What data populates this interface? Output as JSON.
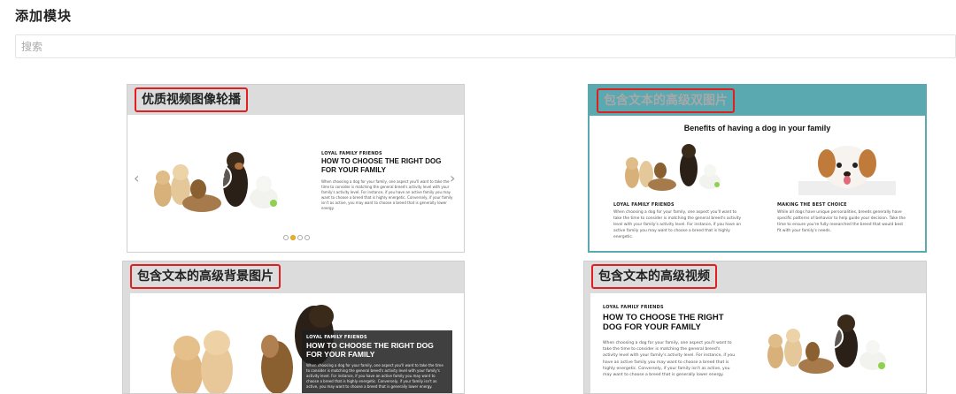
{
  "page": {
    "title": "添加模块"
  },
  "search": {
    "placeholder": "搜索"
  },
  "cards": [
    {
      "label": "优质视频图像轮播",
      "kicker": "LOYAL FAMILY FRIENDS",
      "headline": "HOW TO CHOOSE THE RIGHT DOG FOR YOUR FAMILY",
      "body": "When choosing a dog for your family, one aspect you'll want to take the time to consider is matching the general breed's activity level with your family's activity level. For instance, if you have an active family you may want to choose a breed that is highly energetic. Conversely, if your family isn't as active, you may want to choose a breed that is generally lower energy.",
      "dots": 4,
      "active_dot": 1
    },
    {
      "label": "包含文本的高级双图片",
      "heading": "Benefits of having a dog in your family",
      "left_title": "LOYAL FAMILY FRIENDS",
      "left_body": "When choosing a dog for your family, one aspect you'll want to take the time to consider is matching the general breed's activity level with your family's activity level. For instance, if you have an active family you may want to choose a breed that is highly energetic.",
      "right_title": "MAKING THE BEST CHOICE",
      "right_body": "While all dogs have unique personalities, breeds generally have specific patterns of behavior to help guide your decision. Take the time to ensure you're fully researched the breed that would best fit with your family's needs."
    },
    {
      "label": "包含文本的高级背景图片",
      "kicker": "LOYAL FAMILY FRIENDS",
      "headline": "HOW TO CHOOSE THE RIGHT DOG FOR YOUR FAMILY",
      "body": "When choosing a dog for your family, one aspect you'll want to take the time to consider is matching the general breed's activity level with your family's activity level. For instance, if you have an active family you may want to choose a breed that is highly energetic. Conversely, if your family isn't as active, you may want to choose a breed that is generally lower energy."
    },
    {
      "label": "包含文本的高级视频",
      "kicker": "LOYAL FAMILY FRIENDS",
      "headline": "HOW TO CHOOSE THE RIGHT DOG FOR YOUR FAMILY",
      "body": "When choosing a dog for your family, one aspect you'll want to take the time to consider is matching the general breed's activity level with your family's activity level. For instance, if you have an active family you may want to choose a breed that is highly energetic. Conversely, if your family isn't as active, you may want to choose a breed that is generally lower energy."
    }
  ],
  "colors": {
    "header_gray": "#dcdcdc",
    "header_teal": "#5aa8b0",
    "highlight": "#e02020"
  }
}
